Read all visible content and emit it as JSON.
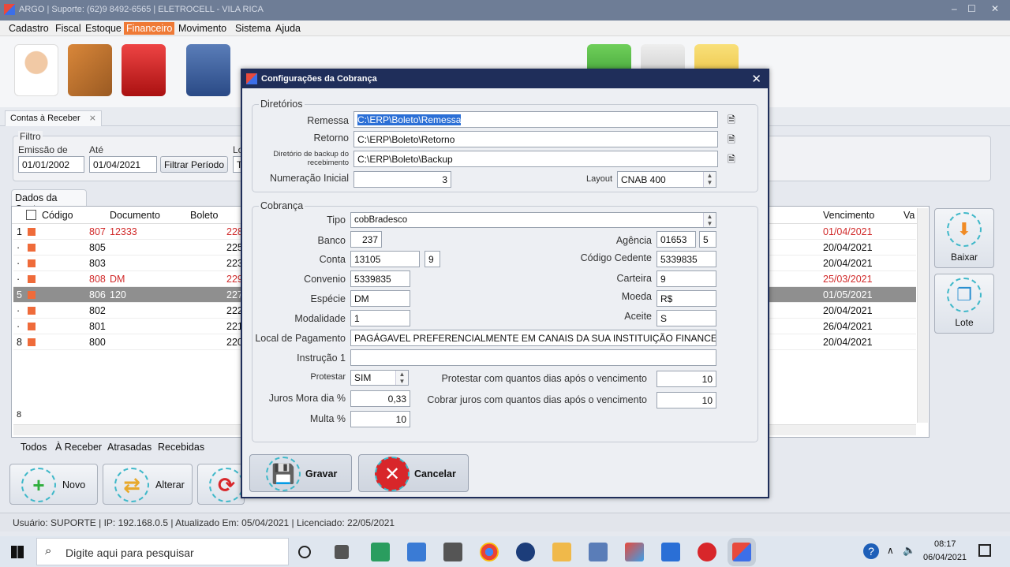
{
  "window": {
    "title": "ARGO | Suporte: (62)9 8492-6565 | ELETROCELL - VILA RICA",
    "min": "–",
    "max": "☐",
    "close": "✕"
  },
  "menu": [
    "Cadastro",
    "Fiscal",
    "Estoque",
    "Financeiro",
    "Movimento",
    "Sistema",
    "Ajuda"
  ],
  "doc_tab": {
    "label": "Contas à Receber",
    "close": "⨯"
  },
  "filtro": {
    "title": "Filtro",
    "emissao_label": "Emissão de",
    "ate_label": "Até",
    "lo_label": "Lo",
    "emissao_value": "01/01/2002",
    "ate_value": "01/04/2021",
    "filtrar_label": "Filtrar Período",
    "t_value": "T"
  },
  "grid": {
    "tab": "Dados da Conta",
    "columns": {
      "codigo": "Código",
      "documento": "Documento",
      "boleto": "Boleto",
      "vencimento": "Vencimento",
      "va": "Va"
    },
    "rows": [
      {
        "idx": "1",
        "codigo": "807",
        "documento": "12333",
        "boleto": "228",
        "vencimento": "01/04/2021"
      },
      {
        "idx": "·",
        "codigo": "805",
        "documento": "",
        "boleto": "225",
        "vencimento": "20/04/2021"
      },
      {
        "idx": "·",
        "codigo": "803",
        "documento": "",
        "boleto": "223",
        "vencimento": "20/04/2021"
      },
      {
        "idx": "·",
        "codigo": "808",
        "documento": "DM",
        "boleto": "229",
        "vencimento": "25/03/2021"
      },
      {
        "idx": "5",
        "codigo": "806",
        "documento": "120",
        "boleto": "227",
        "vencimento": "01/05/2021"
      },
      {
        "idx": "·",
        "codigo": "802",
        "documento": "",
        "boleto": "222",
        "vencimento": "20/04/2021"
      },
      {
        "idx": "·",
        "codigo": "801",
        "documento": "",
        "boleto": "221",
        "vencimento": "26/04/2021"
      },
      {
        "idx": "8",
        "codigo": "800",
        "documento": "",
        "boleto": "220",
        "vencimento": "20/04/2021"
      }
    ],
    "footer_count": "8"
  },
  "side_buttons": {
    "baixar": "Baixar",
    "lote": "Lote"
  },
  "filter_tabs": [
    "Todos",
    "À Receber",
    "Atrasadas",
    "Recebidas"
  ],
  "bottom_buttons": {
    "novo": "Novo",
    "alterar": "Alterar"
  },
  "status": "Usuário: SUPORTE | IP: 192.168.0.5 | Atualizado Em: 05/04/2021 | Licenciado: 22/05/2021",
  "dialog": {
    "title": "Configurações da Cobrança",
    "close": "✕",
    "diretorios": {
      "title": "Diretórios",
      "remessa_label": "Remessa",
      "remessa_value": "C:\\ERP\\Boleto\\Remessa",
      "retorno_label": "Retorno",
      "retorno_value": "C:\\ERP\\Boleto\\Retorno",
      "backup_label_1": "Diretório de backup do",
      "backup_label_2": "recebimento",
      "backup_value": "C:\\ERP\\Boleto\\Backup",
      "numeracao_label": "Numeração Inicial",
      "numeracao_value": "3",
      "layout_label": "Layout",
      "layout_value": "CNAB 400"
    },
    "cobranca": {
      "title": "Cobrança",
      "tipo_label": "Tipo",
      "tipo_value": "cobBradesco",
      "banco_label": "Banco",
      "banco_value": "237",
      "agencia_label": "Agência",
      "agencia_value": "01653",
      "agencia_dv": "5",
      "conta_label": "Conta",
      "conta_value": "13105",
      "conta_dv": "9",
      "cedente_label": "Código Cedente",
      "cedente_value": "5339835",
      "convenio_label": "Convenio",
      "convenio_value": "5339835",
      "carteira_label": "Carteira",
      "carteira_value": "9",
      "especie_label": "Espécie",
      "especie_value": "DM",
      "moeda_label": "Moeda",
      "moeda_value": "R$",
      "modalidade_label": "Modalidade",
      "modalidade_value": "1",
      "aceite_label": "Aceite",
      "aceite_value": "S",
      "local_label": "Local de Pagamento",
      "local_value": "PAGÁGAVEL PREFERENCIALMENTE EM CANAIS DA SUA INSTITUIÇÃO FINANCEIRA",
      "instrucao_label": "Instrução 1",
      "instrucao_value": "",
      "protestar_label": "Protestar",
      "protestar_value": "SIM",
      "protestar_dias_label": "Protestar com quantos dias após o vencimento",
      "protestar_dias_value": "10",
      "juros_label": "Juros Mora dia %",
      "juros_value": "0,33",
      "juros_dias_label": "Cobrar juros com quantos dias após o vencimento",
      "juros_dias_value": "10",
      "multa_label": "Multa %",
      "multa_value": "10"
    },
    "gravar": "Gravar",
    "cancelar": "Cancelar"
  },
  "taskbar": {
    "search_placeholder": "Digite aqui para pesquisar",
    "time": "08:17",
    "date": "06/04/2021"
  }
}
